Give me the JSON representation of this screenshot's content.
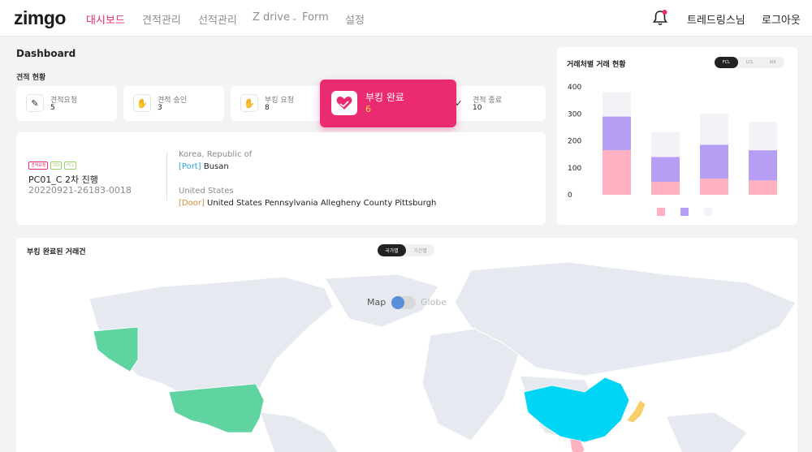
{
  "header": {
    "logo": "zimgo",
    "nav": [
      {
        "label": "대시보드",
        "active": true
      },
      {
        "label": "견적관리"
      },
      {
        "label": "선적관리"
      },
      {
        "label": "Z drive",
        "dropdown": true
      },
      {
        "label": "Form"
      },
      {
        "label": "설정"
      }
    ],
    "user": "트레드링스님",
    "logout": "로그아웃",
    "accent": "#ea2b72"
  },
  "dashboard": {
    "title": "Dashboard",
    "section_title": "견적 현황",
    "stats": [
      {
        "label": "견적요청",
        "value": "5",
        "icon": "document-edit-icon"
      },
      {
        "label": "견적 승인",
        "value": "3",
        "icon": "handshake-icon"
      },
      {
        "label": "부킹 요청",
        "value": "8",
        "icon": "hand-coin-icon"
      },
      {
        "label": "견적 종료",
        "value": "10",
        "icon": "checkmark-icon"
      }
    ],
    "popup": {
      "label": "부킹 완료",
      "value": "6",
      "icon": "heart-hand-icon"
    }
  },
  "shipment": {
    "badges": [
      "견적요청",
      "DD",
      "FCL"
    ],
    "name": "PC01_C 2차 진행",
    "code": "20220921-26183-0018",
    "origin": {
      "country": "Korea, Republic of",
      "type": "[Port]",
      "place": "Busan"
    },
    "destination": {
      "country": "United States",
      "type": "[Door]",
      "place": "United States Pennsylvania Allegheny County Pittsburgh"
    }
  },
  "trade_chart": {
    "title": "거래처별 거래 현황",
    "modes": [
      "FCL",
      "LCL",
      "AIR"
    ],
    "active_mode": "FCL"
  },
  "chart_data": {
    "type": "bar",
    "stacked": true,
    "categories": [
      "",
      "",
      "",
      ""
    ],
    "series": [
      {
        "color": "#ffb1c1",
        "values": [
          165,
          48,
          60,
          53
        ]
      },
      {
        "color": "#b79ef5",
        "values": [
          125,
          92,
          125,
          112
        ]
      },
      {
        "color": "#f3f3f7",
        "values": [
          90,
          93,
          115,
          105
        ]
      }
    ],
    "yticks": [
      "400",
      "300",
      "200",
      "100",
      "0"
    ],
    "ylim": [
      0,
      400
    ],
    "legend": "bottom"
  },
  "map_panel": {
    "title": "부킹 완료된 거래건",
    "tabs": [
      "국가별",
      "기간별"
    ],
    "active_tab": "국가별",
    "toggle_left": "Map",
    "toggle_right": "Globe",
    "highlight_colors": {
      "usa": "#5fd3a0",
      "china": "#00d5f5",
      "japan": "#f5d06a",
      "vietnam": "#ffb1c1",
      "land": "#e6e9ef"
    }
  }
}
